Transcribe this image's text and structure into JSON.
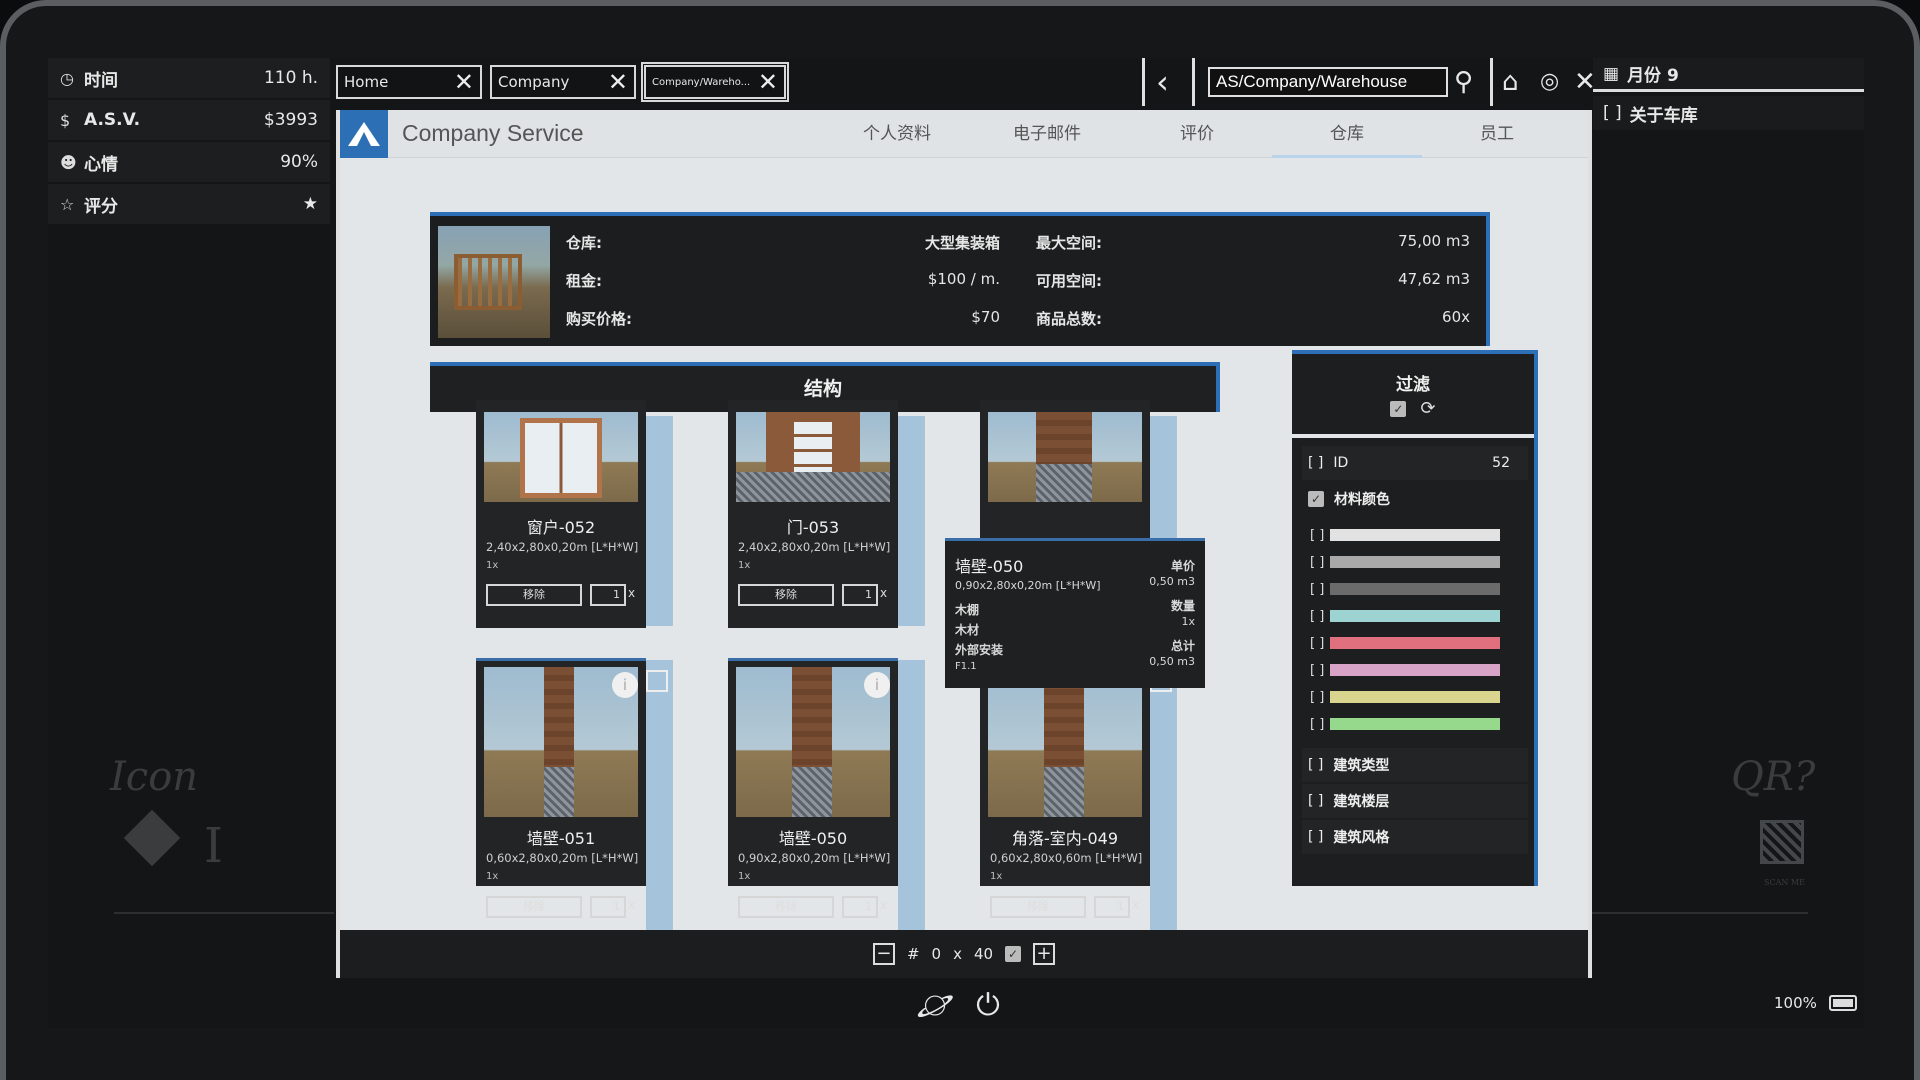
{
  "stats": [
    {
      "icon": "clock-icon",
      "glyph": "◷",
      "label": "时间",
      "value": "110 h."
    },
    {
      "icon": "dollar-icon",
      "glyph": "$",
      "label": "A.S.V.",
      "value": "$3993"
    },
    {
      "icon": "smiley-icon",
      "glyph": "☻",
      "label": "心情",
      "value": "90%"
    },
    {
      "icon": "star-icon",
      "glyph": "☆",
      "label": "评分",
      "value": "★"
    }
  ],
  "right_panel": {
    "month_label": "月份 9",
    "garage_label": "关于车库",
    "bracket": "[ ]"
  },
  "decor": {
    "icon_sketch": "Icon",
    "qr_sketch": "QR?",
    "scan_me": "SCAN ME"
  },
  "browser": {
    "tabs": [
      {
        "label": "Home"
      },
      {
        "label": "Company"
      },
      {
        "label": "Company/Wareho..."
      }
    ],
    "address": "AS/Company/Warehouse"
  },
  "site": {
    "title": "Company Service",
    "nav": [
      "个人资料",
      "电子邮件",
      "评价",
      "仓库",
      "员工"
    ],
    "active_nav": "仓库"
  },
  "warehouse_info": {
    "warehouse_label": "仓库:",
    "warehouse_value": "大型集装箱",
    "rent_label": "租金:",
    "rent_value": "$100 / m.",
    "price_label": "购买价格:",
    "price_value": "$70",
    "max_space_label": "最大空间:",
    "max_space_value": "75,00 m3",
    "free_space_label": "可用空间:",
    "free_space_value": "47,62 m3",
    "total_goods_label": "商品总数:",
    "total_goods_value": "60x"
  },
  "structure": {
    "header": "结构",
    "cards": [
      {
        "title": "窗户-052",
        "dims": "2,40x2,80x0,20m [L*H*W]",
        "qty": "1x",
        "remove": "移除",
        "count": "1",
        "x": "x"
      },
      {
        "title": "门-053",
        "dims": "2,40x2,80x0,20m [L*H*W]",
        "qty": "1x",
        "remove": "移除",
        "count": "1",
        "x": "x"
      },
      {
        "title": "",
        "dims": "",
        "qty": "",
        "remove": "",
        "count": "",
        "x": ""
      },
      {
        "title": "墙壁-051",
        "dims": "0,60x2,80x0,20m [L*H*W]",
        "qty": "1x",
        "remove": "移除",
        "count": "1",
        "x": "x"
      },
      {
        "title": "墙壁-050",
        "dims": "0,90x2,80x0,20m [L*H*W]",
        "qty": "1x",
        "remove": "移除",
        "count": "1",
        "x": "x"
      },
      {
        "title": "角落-室内-049",
        "dims": "0,60x2,80x0,60m [L*H*W]",
        "qty": "1x",
        "remove": "移除",
        "count": "1",
        "x": "x"
      }
    ],
    "info_glyph": "i"
  },
  "tooltip": {
    "title": "墙壁-050",
    "dims": "0,90x2,80x0,20m [L*H*W]",
    "lines": [
      "木棚",
      "木材",
      "外部安装",
      "F1.1"
    ],
    "unit_label": "单价",
    "unit_value": "0,50 m3",
    "qty_label": "数量",
    "qty_value": "1x",
    "total_label": "总计",
    "total_value": "0,50 m3"
  },
  "filter": {
    "title": "过滤",
    "id_label": "ID",
    "id_value": "52",
    "material_color_label": "材料颜色",
    "bracket": "[ ]",
    "colors": [
      "#e2e2e2",
      "#a9a9a9",
      "#6b6b6b",
      "#9dd3d3",
      "#e0707e",
      "#d7a3c6",
      "#d9d58e",
      "#97d98c"
    ],
    "building_type": "建筑类型",
    "building_floor": "建筑楼层",
    "building_style": "建筑风格"
  },
  "pager": {
    "hash": "#",
    "page": "0",
    "x": "x",
    "per_page": "40"
  },
  "battery": {
    "percent": "100%"
  },
  "colors": {
    "accent": "#2d6fb6",
    "light_blue": "#a5c4dc",
    "page_bg": "#e3e6e8",
    "panel": "#1d1e1f"
  }
}
